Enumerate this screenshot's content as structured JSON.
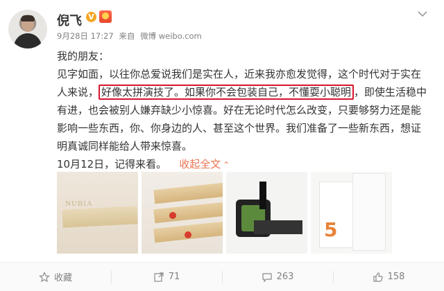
{
  "author": {
    "name": "倪飞",
    "badge": "V",
    "avatar": "avatar"
  },
  "meta": {
    "date": "9月28日 17:27",
    "source_prefix": "来自",
    "source": "微博 weibo.com"
  },
  "post": {
    "greeting": "我的朋友：",
    "line1": "见字如面，以往你总爱说我们是实在人，近来我亦愈发觉得，这个时代对于实在",
    "line2_before": "人来说，",
    "line2_highlight": "好像太拼演技了。如果你不会包装自己，不懂耍小聪明",
    "line2_after": "，即使生活稳中",
    "line3": "有进，也会被别人嫌弃缺少小惊喜。好在无论时代怎么改变，只要够努力还是能",
    "line4": "影响一些东西，你、你身边的人、甚至这个世界。我们准备了一些新东西，想证",
    "line5": "明真诚同样能给人带来惊喜。",
    "last_line": "10月12日，记得来看。",
    "expand_label": "收起全文",
    "highlight_color": "#d7142b",
    "link_color": "#eb7350"
  },
  "images": [
    {
      "name": "nubia-wood-block-photo",
      "logo": "NUBIA"
    },
    {
      "name": "wooden-sticks-photo"
    },
    {
      "name": "film-reel-photo"
    },
    {
      "name": "product-box-photo",
      "mark": "5"
    }
  ],
  "actions": {
    "favorite_label": "收藏",
    "repost_count": "71",
    "comment_count": "263",
    "like_count": "158"
  },
  "icons": {
    "more": "chevron-down-icon",
    "favorite": "star-icon",
    "repost": "share-icon",
    "comment": "comment-icon",
    "like": "thumbs-up-icon",
    "vip": "verified-badge-icon",
    "medal": "medal-icon"
  }
}
